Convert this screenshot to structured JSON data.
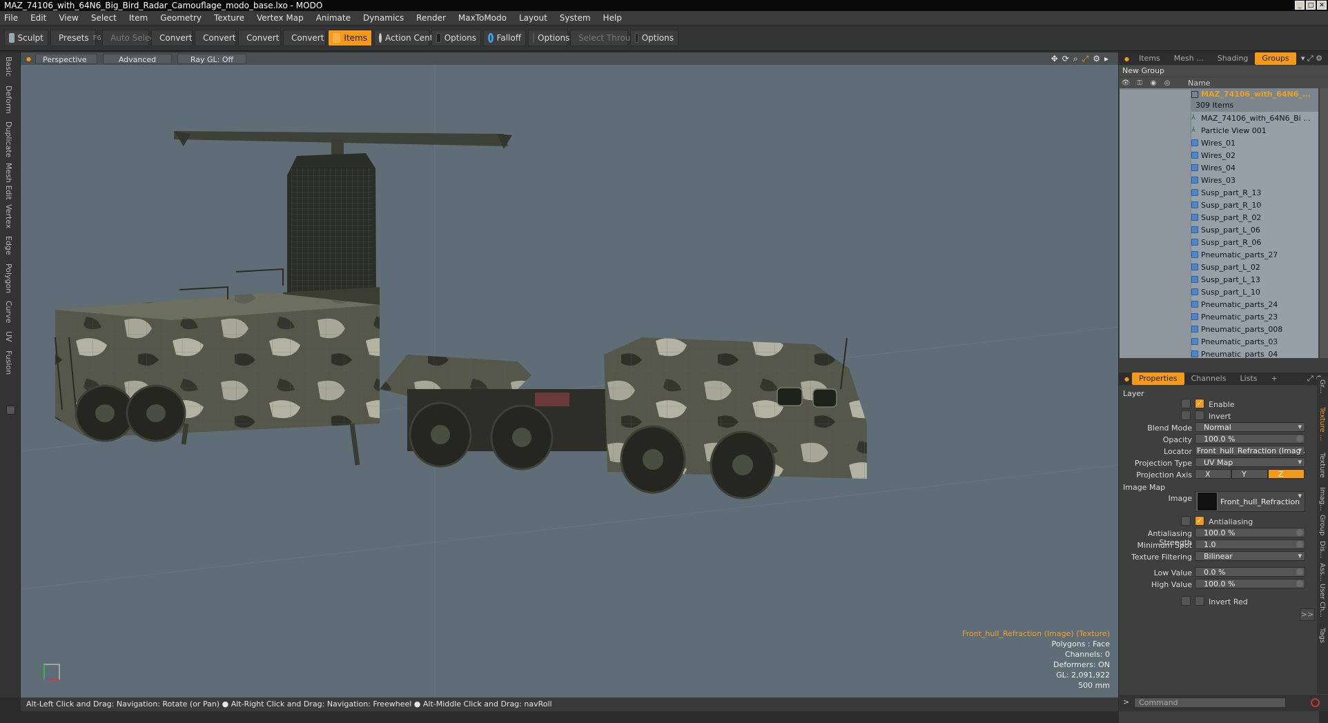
{
  "window": {
    "title": "MAZ_74106_with_64N6_Big_Bird_Radar_Camouflage_modo_base.lxo - MODO",
    "controls": [
      "_",
      "□",
      "✕"
    ]
  },
  "menu": [
    "File",
    "Edit",
    "View",
    "Select",
    "Item",
    "Geometry",
    "Texture",
    "Vertex Map",
    "Animate",
    "Dynamics",
    "Render",
    "MaxToModo",
    "Layout",
    "System",
    "Help"
  ],
  "toolbar": {
    "sculpt": "Sculpt",
    "presets": "Presets",
    "presets_key": "F6",
    "auto_select": "Auto Select",
    "convert1": "Convert",
    "convert2": "Convert",
    "convert3": "Convert",
    "convert4": "Convert",
    "items": "Items",
    "action_center": "Action Center",
    "options1": "Options",
    "falloff": "Falloff",
    "options2": "Options",
    "select_through": "Select Through",
    "options3": "Options"
  },
  "left_tabs": [
    "Basic",
    "Deform",
    "Duplicate",
    "Mesh Edit",
    "Vertex",
    "Edge",
    "Polygon",
    "Curve",
    "UV",
    "Fusion"
  ],
  "viewport": {
    "view": "Perspective",
    "shading": "Advanced",
    "raygl": "Ray GL: Off",
    "info": {
      "selection": "Front_hull_Refraction (Image) (Texture)",
      "polygons": "Polygons : Face",
      "channels": "Channels: 0",
      "deformers": "Deformers: ON",
      "gl": "GL: 2,091,922",
      "scale": "500 mm"
    }
  },
  "status": "Alt-Left Click and Drag: Navigation: Rotate (or Pan) ● Alt-Right Click and Drag: Navigation: Freewheel ● Alt-Middle Click and Drag: navRoll",
  "items_panel": {
    "tabs": [
      "Items",
      "Mesh ...",
      "Shading",
      "Groups"
    ],
    "active_tab": "Groups",
    "new_group": "New Group",
    "name_col": "Name",
    "group_name": "MAZ_74106_with_64N6_...",
    "group_count": "309 Items",
    "items": [
      {
        "name": "MAZ_74106_with_64N6_Bi ...",
        "type": "locator"
      },
      {
        "name": "Particle View 001",
        "type": "locator"
      },
      {
        "name": "Wires_01",
        "type": "mesh"
      },
      {
        "name": "Wires_02",
        "type": "mesh"
      },
      {
        "name": "Wires_04",
        "type": "mesh"
      },
      {
        "name": "Wires_03",
        "type": "mesh"
      },
      {
        "name": "Susp_part_R_13",
        "type": "mesh"
      },
      {
        "name": "Susp_part_R_10",
        "type": "mesh"
      },
      {
        "name": "Susp_part_R_02",
        "type": "mesh"
      },
      {
        "name": "Susp_part_L_06",
        "type": "mesh"
      },
      {
        "name": "Susp_part_R_06",
        "type": "mesh"
      },
      {
        "name": "Pneumatic_parts_27",
        "type": "mesh"
      },
      {
        "name": "Susp_part_L_02",
        "type": "mesh"
      },
      {
        "name": "Susp_part_L_13",
        "type": "mesh"
      },
      {
        "name": "Susp_part_L_10",
        "type": "mesh"
      },
      {
        "name": "Pneumatic_parts_24",
        "type": "mesh"
      },
      {
        "name": "Pneumatic_parts_23",
        "type": "mesh"
      },
      {
        "name": "Pneumatic_parts_008",
        "type": "mesh"
      },
      {
        "name": "Pneumatic_parts_03",
        "type": "mesh"
      },
      {
        "name": "Pneumatic_parts_04",
        "type": "mesh"
      }
    ]
  },
  "properties": {
    "tabs": [
      "Properties",
      "Channels",
      "Lists",
      "+"
    ],
    "active_tab": "Properties",
    "layer_section": "Layer",
    "enable": "Enable",
    "invert": "Invert",
    "blend_mode_label": "Blend Mode",
    "blend_mode": "Normal",
    "opacity_label": "Opacity",
    "opacity": "100.0 %",
    "locator_label": "Locator",
    "locator": "Front_hull_Refraction (Imag ...",
    "projection_type_label": "Projection Type",
    "projection_type": "UV Map",
    "projection_axis_label": "Projection Axis",
    "axes": [
      "X",
      "Y",
      "Z"
    ],
    "active_axis": "Z",
    "image_map_section": "Image Map",
    "image_label": "Image",
    "image": "Front_hull_Refraction",
    "antialiasing": "Antialiasing",
    "aa_strength_label": "Antialiasing Strength",
    "aa_strength": "100.0 %",
    "min_spot_label": "Minimum Spot",
    "min_spot": "1.0",
    "tex_filter_label": "Texture Filtering",
    "tex_filter": "Bilinear",
    "low_label": "Low Value",
    "low": "0.0 %",
    "high_label": "High Value",
    "high": "100.0 %",
    "invert_red": "Invert Red",
    "more": ">>"
  },
  "right_vtabs": [
    "Gr...",
    "Texture ...",
    "Texture",
    "Imag...",
    "Group",
    "Dis...",
    "Ass...",
    "User Ch...",
    "Tags"
  ],
  "command": {
    "placeholder": "Command",
    "prompt": ">"
  },
  "colors": {
    "accent": "#f39a1b",
    "viewport_bg": "#5f6e76",
    "list_bg": "#95a0a8",
    "group_name": "#f0a020"
  }
}
